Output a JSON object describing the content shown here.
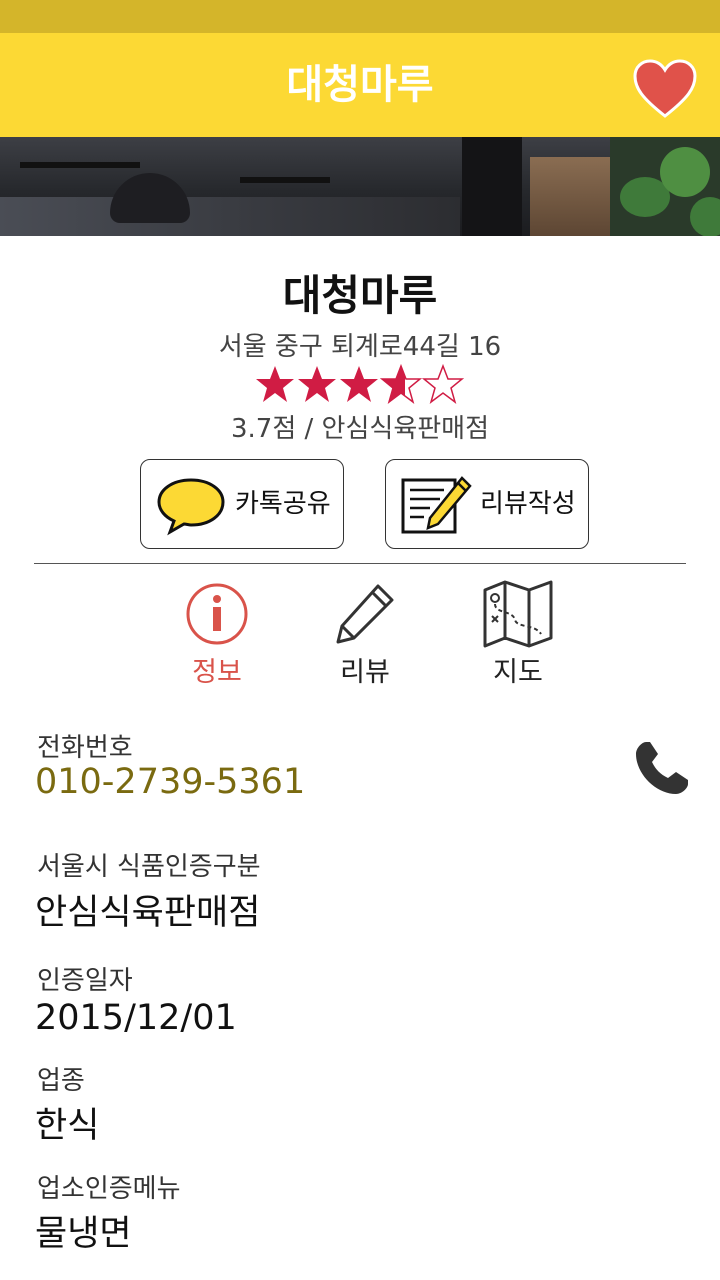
{
  "header": {
    "title": "대청마루"
  },
  "store": {
    "name": "대청마루",
    "address": "서울 중구 퇴계로44길 16",
    "rating_value": 3.7,
    "rating_max": 5,
    "rating_text": "3.7점 / 안심식육판매점"
  },
  "actions": {
    "kakao_label": "카톡공유",
    "review_label": "리뷰작성"
  },
  "tabs": [
    {
      "label": "정보",
      "icon": "info-icon",
      "active": true
    },
    {
      "label": "리뷰",
      "icon": "pencil-icon",
      "active": false
    },
    {
      "label": "지도",
      "icon": "map-icon",
      "active": false
    }
  ],
  "details": {
    "phone_label": "전화번호",
    "phone_value": "010-2739-5361",
    "cert_type_label": "서울시 식품인증구분",
    "cert_type_value": "안심식육판매점",
    "cert_date_label": "인증일자",
    "cert_date_value": "2015/12/01",
    "category_label": "업종",
    "category_value": "한식",
    "menu_label": "업소인증메뉴",
    "menu_value": "물냉면"
  },
  "colors": {
    "status_bar": "#d4b52a",
    "app_bar": "#fcd934",
    "star": "#d01c44",
    "active_tab": "#d9534a",
    "heart": "#e0524a",
    "phone_text": "#7a6a10"
  }
}
